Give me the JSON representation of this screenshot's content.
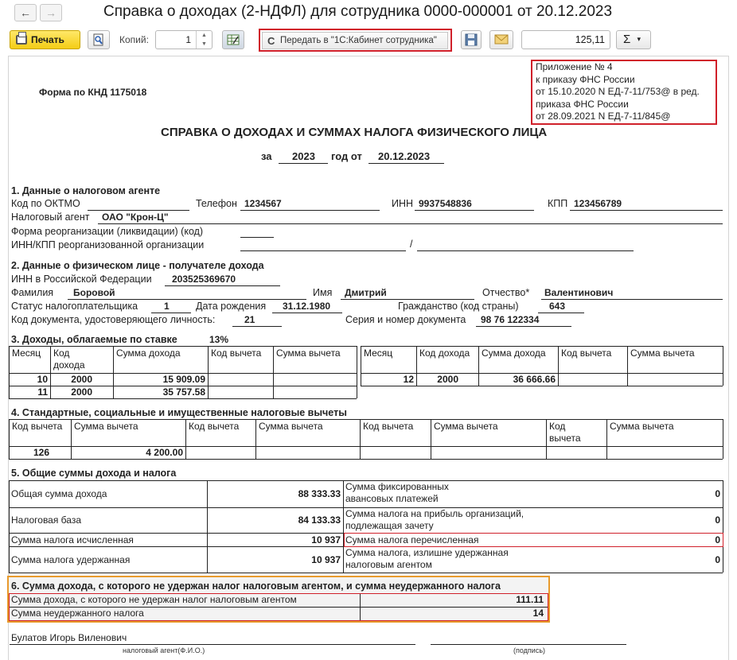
{
  "window": {
    "title": "Справка о доходах (2-НДФЛ) для сотрудника 0000-000001 от 20.12.2023",
    "back_icon": "←",
    "forward_icon": "→"
  },
  "toolbar": {
    "print_label": "Печать",
    "copies_label": "Копий:",
    "copies_value": "1",
    "send_label": "Передать в \"1С:Кабинет сотрудника\"",
    "sum_value": "125,11",
    "sigma": "Σ",
    "dropdown_arrow": "▾"
  },
  "doc": {
    "knd": "Форма по КНД 1175018",
    "appendix": {
      "line1": "Приложение № 4",
      "line2": "к приказу ФНС России",
      "line3": "от 15.10.2020 N ЕД-7-11/753@ в ред.",
      "line4": "приказа ФНС России",
      "line5": "от 28.09.2021 N ЕД-7-11/845@"
    },
    "heading": "СПРАВКА О ДОХОДАХ И СУММАХ НАЛОГА ФИЗИЧЕСКОГО ЛИЦА",
    "for_label": "за",
    "year": "2023",
    "year_from_label": "год от",
    "date": "20.12.2023",
    "s1": {
      "title": "1. Данные о налоговом агенте",
      "oktmo_label": "Код по ОКТМО",
      "phone_label": "Телефон",
      "phone": "1234567",
      "inn_label": "ИНН",
      "inn": "9937548836",
      "kpp_label": "КПП",
      "kpp": "123456789",
      "agent_label": "Налоговый агент",
      "agent": "ОАО \"Крон-Ц\"",
      "reorg_label": "Форма реорганизации (ликвидации)  (код)",
      "reorg_inn_label": "ИНН/КПП  реорганизованной организации",
      "slash": "/"
    },
    "s2": {
      "title": "2. Данные о физическом лице - получателе дохода",
      "inn_label": "ИНН в Российской Федерации",
      "inn": "203525369670",
      "surname_label": "Фамилия",
      "surname": "Боровой",
      "name_label": "Имя",
      "name": "Дмитрий",
      "patronymic_label": "Отчество*",
      "patronymic": "Валентинович",
      "status_label": "Статус налогоплательщика",
      "status": "1",
      "birth_label": "Дата рождения",
      "birth": "31.12.1980",
      "citizenship_label": "Гражданство (код страны)",
      "citizenship": "643",
      "doc_code_label": "Код документа, удостоверяющего личность:",
      "doc_code": "21",
      "doc_series_label": "Серия и номер документа",
      "doc_series": "98 76 122334"
    },
    "s3": {
      "title": "3. Доходы, облагаемые по ставке",
      "rate": "13%",
      "headers": [
        "Месяц",
        "Код дохода",
        "Сумма дохода",
        "Код вычета",
        "Сумма вычета"
      ],
      "code_header_top": "Код",
      "code_header_bottom": "дохода",
      "rows": [
        {
          "month": "10",
          "code": "2000",
          "amount": "15 909.09"
        },
        {
          "month": "11",
          "code": "2000",
          "amount": "35 757.58"
        }
      ],
      "rows_right": [
        {
          "month": "12",
          "code": "2000",
          "amount": "36 666.66"
        }
      ]
    },
    "s4": {
      "title": "4. Стандартные, социальные и имущественные налоговые вычеты",
      "h_code": "Код вычета",
      "h_sum": "Сумма вычета",
      "h_code_top": "Код",
      "h_code_bottom": "вычета",
      "code": "126",
      "sum": "4 200.00"
    },
    "s5": {
      "title": "5. Общие суммы дохода и налога",
      "total_income_label": "Общая сумма дохода",
      "total_income": "88 333.33",
      "tax_base_label": "Налоговая база",
      "tax_base": "84 133.33",
      "tax_calc_label": "Сумма налога исчисленная",
      "tax_calc": "10 937",
      "tax_withheld_label": "Сумма налога удержанная",
      "tax_withheld": "10 937",
      "fixed_adv_label_1": "Сумма фиксированных",
      "fixed_adv_label_2": "авансовых платежей",
      "fixed_adv": "0",
      "profit_tax_label_1": "Сумма налога на прибыль организаций,",
      "profit_tax_label_2": "подлежащая зачету",
      "profit_tax": "0",
      "transferred_label": "Сумма налога перечисленная",
      "transferred": "0",
      "excess_label_1": "Сумма налога, излишне удержанная",
      "excess_label_2": "налоговым агентом",
      "excess": "0"
    },
    "s6": {
      "title": "6. Сумма дохода, с которого не удержан налог налоговым агентом, и сумма неудержанного налога",
      "income_label": "Сумма дохода, с которого не удержан налог налоговым агентом",
      "income": "111.11",
      "tax_label": "Сумма неудержанного налога",
      "tax": "14"
    },
    "signature": {
      "name": "Булатов Игорь Виленович",
      "agent_caption": "налоговый агент(Ф.И.О.)",
      "sign_caption": "(подпись)"
    }
  }
}
